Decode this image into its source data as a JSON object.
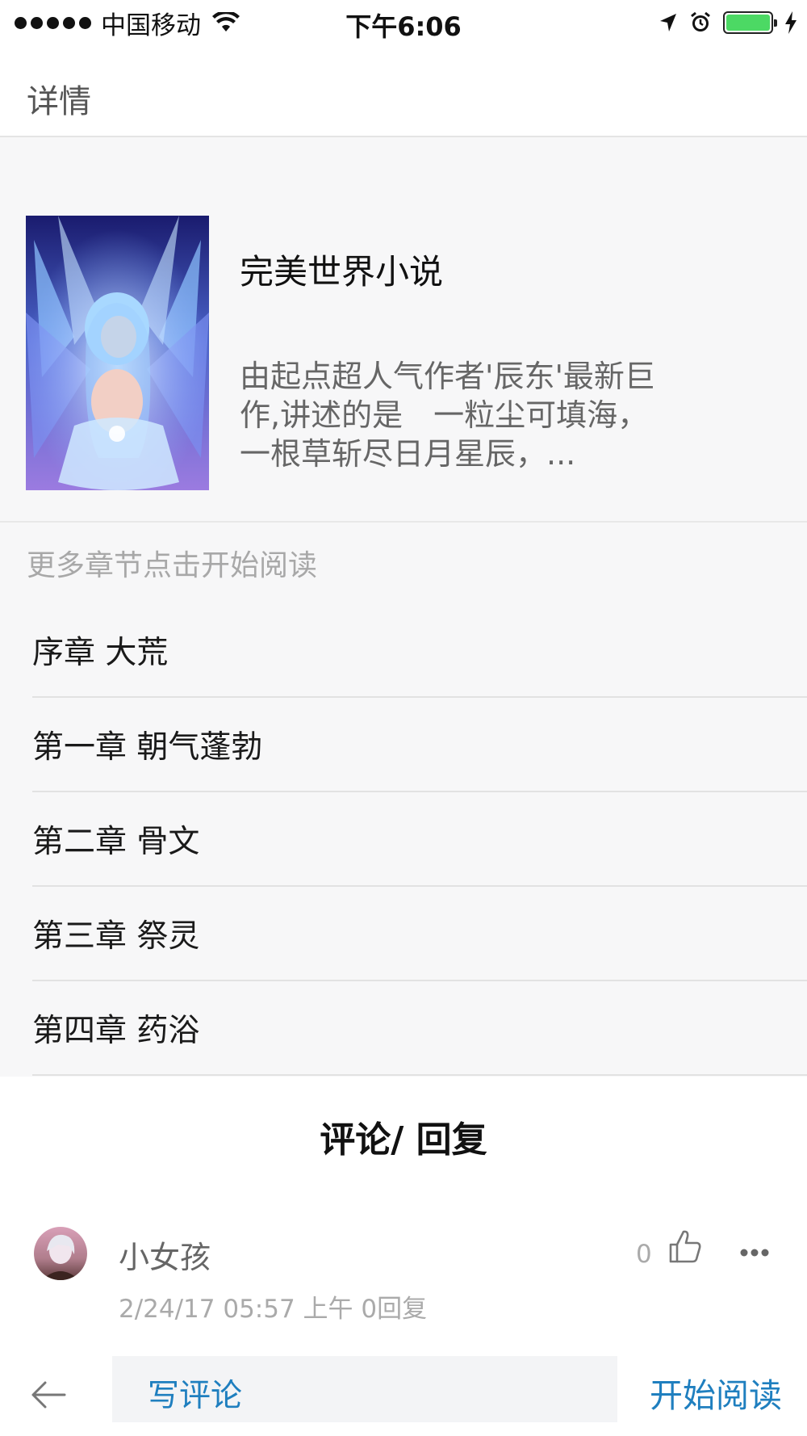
{
  "status_bar": {
    "carrier": "中国移动",
    "time": "下午6:06",
    "battery_level": 1.0
  },
  "nav": {
    "title": "详情"
  },
  "book": {
    "title": "完美世界小说",
    "description": "由起点超人气作者'辰东'最新巨作,讲述的是　一粒尘可填海，一根草斩尽日月星辰，..."
  },
  "chapters": {
    "hint": "更多章节点击开始阅读",
    "items": [
      {
        "label": "序章 大荒"
      },
      {
        "label": "第一章 朝气蓬勃"
      },
      {
        "label": "第二章 骨文"
      },
      {
        "label": "第三章 祭灵"
      },
      {
        "label": "第四章 药浴"
      }
    ]
  },
  "comments": {
    "title": "评论/ 回复",
    "items": [
      {
        "user": "小女孩",
        "meta": "2/24/17 05:57 上午  0回复",
        "likes": "0"
      }
    ]
  },
  "bottom_bar": {
    "write_comment": "写评论",
    "start_reading": "开始阅读"
  },
  "colors": {
    "accent": "#1f7fbf",
    "battery": "#4cd964",
    "section_bg": "#f7f7f8"
  },
  "icons": [
    "signal-dots",
    "wifi-icon",
    "location-icon",
    "alarm-icon",
    "battery-icon",
    "charging-icon",
    "thumbs-up-icon",
    "more-icon",
    "back-arrow-icon"
  ]
}
